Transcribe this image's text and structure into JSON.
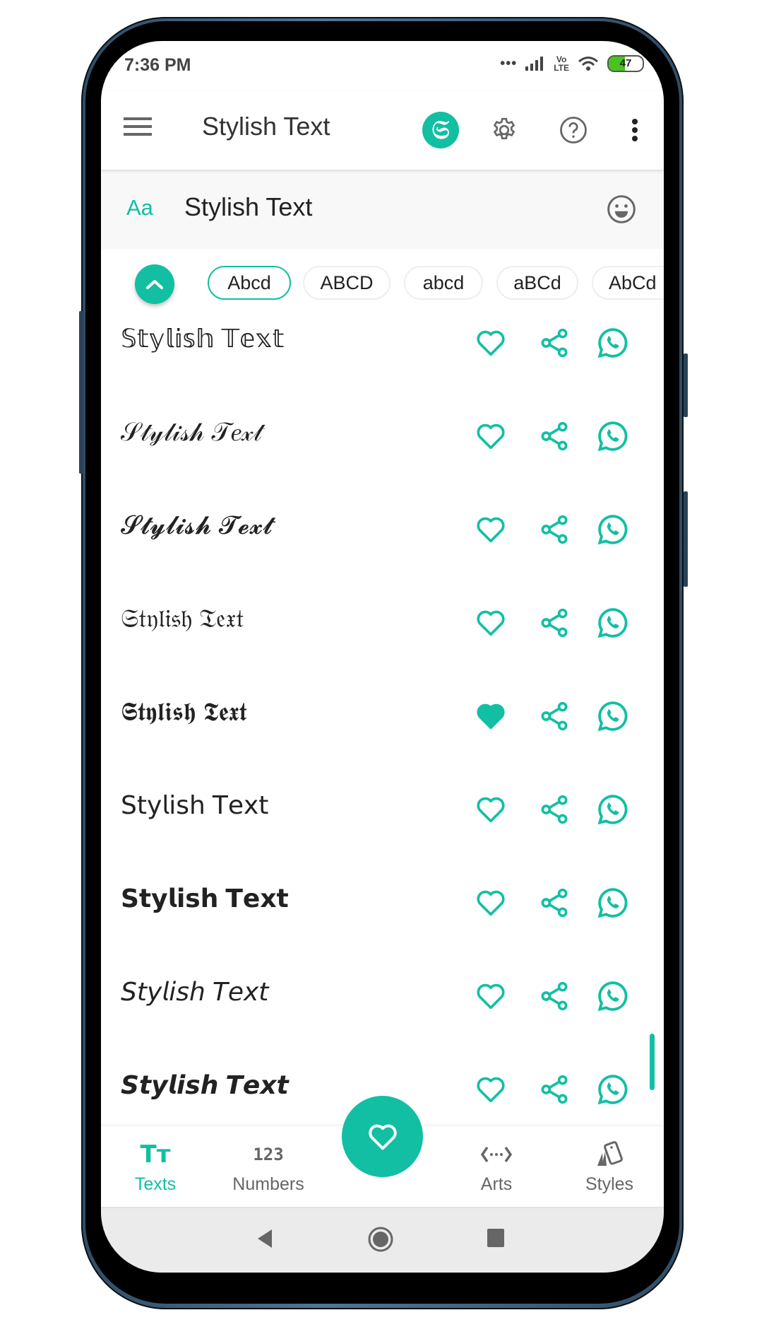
{
  "status_bar": {
    "time": "7:36 PM",
    "signal_dots": "•••",
    "network": "VoLTE",
    "lte_top": "Vo",
    "lte_bottom": "LTE",
    "battery_level": "47",
    "battery_fraction": 0.47
  },
  "app_bar": {
    "title": "Stylish Text",
    "badge_letter": "𝔖",
    "icons": [
      "menu-icon",
      "app-logo-icon",
      "settings-icon",
      "help-icon",
      "more-vert-icon"
    ]
  },
  "input": {
    "prefix": "Aa",
    "value": "Stylish Text",
    "emoji_icon": "emoji-icon"
  },
  "case_chips": [
    {
      "label": "Abcd",
      "selected": true
    },
    {
      "label": "ABCD",
      "selected": false
    },
    {
      "label": "abcd",
      "selected": false
    },
    {
      "label": "aBCd",
      "selected": false
    },
    {
      "label": "AbCd",
      "selected": false
    }
  ],
  "styles": [
    {
      "text": "𝕊𝕥𝕪𝕝𝕚𝕤𝕙 𝕋𝕖𝕩𝕥",
      "favorite": false
    },
    {
      "text": "𝒮𝓉𝓎𝓁𝒾𝓈𝒽 𝒯𝑒𝓍𝓉",
      "favorite": false
    },
    {
      "text": "𝓢𝓽𝔂𝓵𝓲𝓼𝓱 𝓣𝓮𝔁𝓽",
      "favorite": false
    },
    {
      "text": "𝔖𝔱𝔶𝔩𝔦𝔰𝔥 𝔗𝔢𝔵𝔱",
      "favorite": false
    },
    {
      "text": "𝕾𝖙𝖞𝖑𝖎𝖘𝖍 𝕿𝖊𝖝𝖙",
      "favorite": true
    },
    {
      "text": "𝖲𝗍𝗒𝗅𝗂𝗌𝗁 𝖳𝖾𝗑𝗍",
      "favorite": false
    },
    {
      "text": "𝗦𝘁𝘆𝗹𝗶𝘀𝗵 𝗧𝗲𝘅𝘁",
      "favorite": false
    },
    {
      "text": "𝘚𝘵𝘺𝘭𝘪𝘴𝘩 𝘛𝘦𝘹𝘵",
      "favorite": false
    },
    {
      "text": "𝙎𝙩𝙮𝙡𝙞𝙨𝙝 𝙏𝙚𝙭𝙩",
      "favorite": false
    }
  ],
  "bottom_nav": [
    {
      "label": "Texts",
      "icon": "Tт",
      "active": true
    },
    {
      "label": "Numbers",
      "icon": "123",
      "active": false
    },
    {
      "label": "Arts",
      "icon": "‹···›",
      "active": false
    },
    {
      "label": "Styles",
      "icon": "styles-icon",
      "active": false
    }
  ],
  "fab": {
    "icon": "heart-icon"
  },
  "colors": {
    "accent": "#12bfa3",
    "icon_gray": "#666666"
  }
}
